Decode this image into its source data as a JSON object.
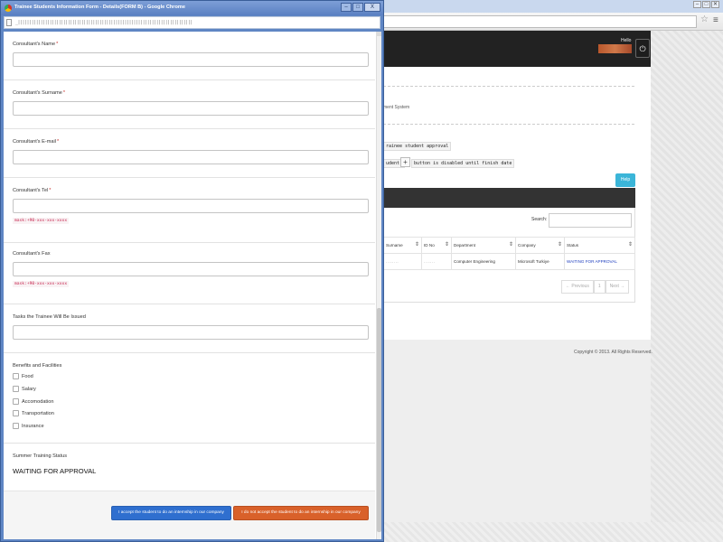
{
  "background_window": {
    "window_controls": [
      "–",
      "□",
      "✕"
    ],
    "hello_text": "Hello",
    "system_text": "ment System",
    "approval_text": "rainee student approval",
    "student_text": "udent.",
    "plus_symbol": "+",
    "disabled_text": "button is disabled until finish date",
    "help_label": "Help",
    "search_label": "Search:",
    "table": {
      "headers": [
        "Surname",
        "ID No",
        "Department",
        "Company",
        "Status"
      ],
      "rows": [
        [
          "........",
          ".......",
          "Computer Engineering",
          "Microsoft Turkiye",
          "WAITING FOR APPROVAL"
        ]
      ]
    },
    "pager": [
      "← Previous",
      "1",
      "Next →"
    ],
    "copyright": "Copyright © 2013. All Rights Reserved."
  },
  "popup": {
    "title": "Trainee Students Information Form - Details(FORM B) - Google Chrome",
    "window_controls": [
      "–",
      "□",
      "X"
    ],
    "url": "_|||||||||||||||||||||||||||||||||||||||||||||||||||||||||||||||||||||||||||||",
    "form": {
      "consultant_name_label": "Consultant's Name",
      "consultant_surname_label": "Consultant's Surname",
      "consultant_email_label": "Consultant's E-mail",
      "consultant_tel_label": "Consultant's Tel",
      "consultant_fax_label": "Consultant's Fax",
      "required_mark": "*",
      "phone_mask": "mask:+90-xxx-xxx-xxxx",
      "tasks_label": "Tasks the Trainee Will Be Issued",
      "benefits_label": "Benefits and Facilities",
      "benefits": [
        "Food",
        "Salary",
        "Accomodation",
        "Transportation",
        "Insurance"
      ],
      "status_label": "Summer Training Status",
      "status_value": "WAITING FOR APPROVAL",
      "accept_button": "I accept the student to do an internship in our company",
      "reject_button": "I do not accept the student to do an internship in our company"
    }
  },
  "colors": {
    "accept": "#2f6fcf",
    "reject": "#d9612a",
    "help": "#3bb5d8",
    "status_link": "#1f3fbf",
    "popup_frame": "#5f86c4"
  }
}
